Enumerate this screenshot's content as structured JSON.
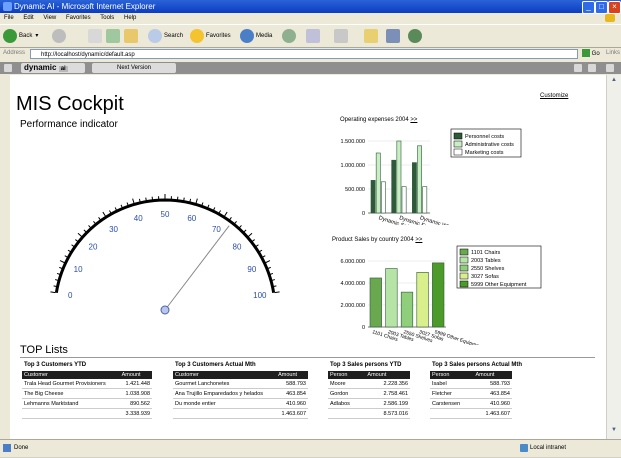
{
  "window": {
    "title": "Dynamic AI - Microsoft Internet Explorer"
  },
  "menu": [
    "File",
    "Edit",
    "View",
    "Favorites",
    "Tools",
    "Help"
  ],
  "toolbar": {
    "back": "Back",
    "search": "Search",
    "favorites": "Favorites",
    "media": "Media"
  },
  "address": {
    "label": "Address",
    "url": "http://localhost/dynamic/default.asp",
    "go": "Go",
    "links": "Links"
  },
  "tabs": {
    "main": "dynamic",
    "next": "Next Version"
  },
  "page": {
    "title": "MIS Cockpit",
    "customize": "Customize",
    "section": "Performance indicator"
  },
  "gauge": {
    "labels": [
      "0",
      "10",
      "20",
      "30",
      "40",
      "50",
      "60",
      "70",
      "80",
      "90",
      "100"
    ],
    "value_fraction": 0.73
  },
  "chart_data": [
    {
      "type": "bar",
      "title": "Operating expenses 2004",
      "categories": [
        "Dynamic Sales",
        "Dynamic Furniture",
        "Dynamic Wholesale"
      ],
      "ylim": [
        0,
        1500000
      ],
      "yticks": [
        "0",
        "500.000",
        "1.000.000",
        "1.500.000"
      ],
      "series": [
        {
          "name": "Personnel costs",
          "values": [
            680000,
            1100000,
            1050000
          ]
        },
        {
          "name": "Administrative costs",
          "values": [
            1250000,
            1500000,
            1400000
          ]
        },
        {
          "name": "Marketing costs",
          "values": [
            650000,
            550000,
            550000
          ]
        }
      ],
      "legend": "right"
    },
    {
      "type": "bar",
      "title": "Product Sales by country 2004",
      "categories": [
        "1101 Chairs",
        "2003 Tables",
        "2550 Shelves",
        "3027 Sofas",
        "5999 Other Equipment"
      ],
      "ylim": [
        0,
        7000000
      ],
      "yticks": [
        "0",
        "2.000.000",
        "4.000.000",
        "6.000.000"
      ],
      "series": [
        {
          "name": "",
          "values": [
            5200000,
            6200000,
            3700000,
            5800000,
            6800000
          ]
        }
      ],
      "legend": "right"
    }
  ],
  "top": {
    "title": "TOP Lists",
    "t1": {
      "title": "Top 3 Customers YTD",
      "cols": [
        "Customer",
        "Amount"
      ],
      "rows": [
        [
          "Trala Head Gourmet Provisioners",
          "1.421.448"
        ],
        [
          "The Big Cheese",
          "1.038.908"
        ],
        [
          "Lehmanns Marktstand",
          "890.562"
        ]
      ],
      "total": "3.338.939"
    },
    "t2": {
      "title": "Top 3 Customers Actual Mth",
      "cols": [
        "Customer",
        "Amount"
      ],
      "rows": [
        [
          "Gourmet Lanchonetes",
          "588.793"
        ],
        [
          "Ana Trujillo Emparedados y helados",
          "463.854"
        ],
        [
          "Du monde entier",
          "410.960"
        ]
      ],
      "total": "1.463.607"
    },
    "t3": {
      "title": "Top 3 Sales persons YTD",
      "cols": [
        "Person",
        "Amount"
      ],
      "rows": [
        [
          "Moore",
          "2.228.356"
        ],
        [
          "Gordon",
          "2.758.461"
        ],
        [
          "Adlabos",
          "2.586.199"
        ]
      ],
      "total": "8.573.016"
    },
    "t4": {
      "title": "Top 3 Sales persons Actual Mth",
      "cols": [
        "Person",
        "Amount"
      ],
      "rows": [
        [
          "Isabel",
          "588.793"
        ],
        [
          "Fletcher",
          "463.854"
        ],
        [
          "Carstensen",
          "410.960"
        ]
      ],
      "total": "1.463.607"
    }
  },
  "status": {
    "left": "Done",
    "zone": "Local intranet"
  },
  "colors": {
    "bar1": "#2e5a3a",
    "bar2": "#c9eec4",
    "bar3": "#ffffff",
    "sales": [
      "#6aa84f",
      "#b6e3a6",
      "#8fce7a",
      "#d9ef8b",
      "#4c9a2a"
    ]
  }
}
